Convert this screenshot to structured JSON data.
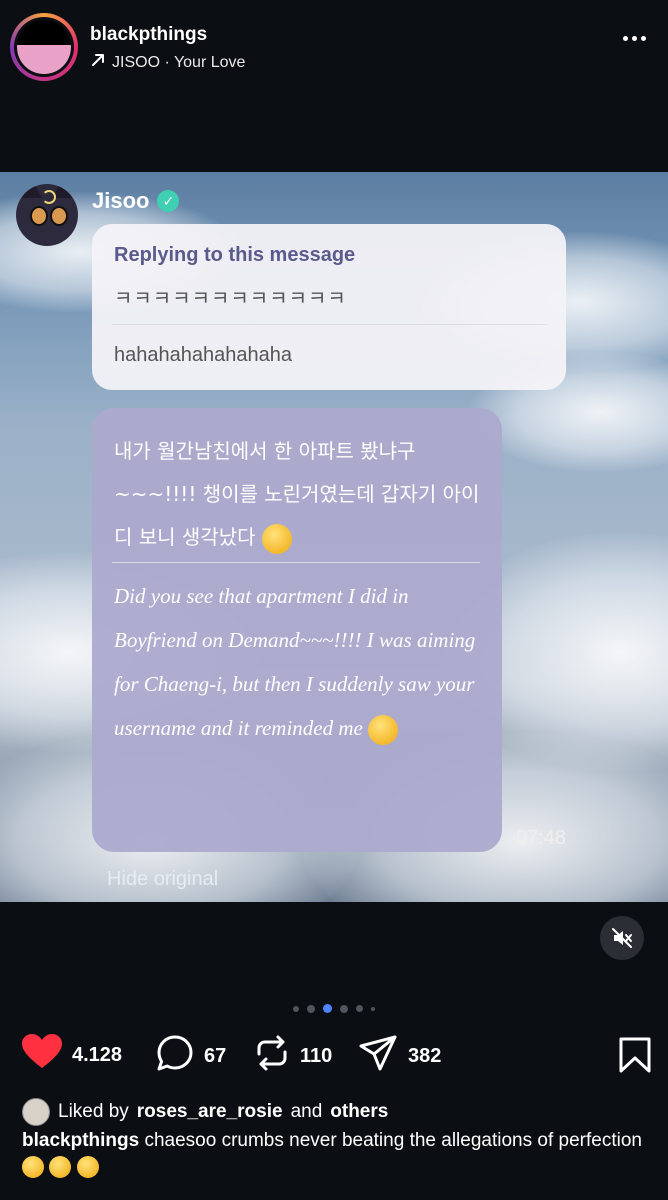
{
  "post": {
    "username": "blackpthings",
    "music": "JISOO · Your Love"
  },
  "chat": {
    "sender": "Jisoo",
    "reply_title": "Replying to this message",
    "reply_original": "ㅋㅋㅋㅋㅋㅋㅋㅋㅋㅋㅋㅋ",
    "reply_translation": "hahahahahahahaha",
    "message_original": "내가 월간남친에서 한 아파트 봤냐구 ~~~!!!! 챙이를 노린거였는데 갑자기 아이디 보니 생각났다",
    "message_translation": "Did you see that apartment I did in Boyfriend on Demand~~~!!!! I was aiming for Chaeng-i, but then I suddenly saw your username and it reminded me",
    "time": "07:48",
    "hide_original": "Hide original"
  },
  "carousel": {
    "count": 6,
    "active_index": 2
  },
  "actions": {
    "likes": "4.128",
    "comments": "67",
    "reposts": "110",
    "shares": "382"
  },
  "liked_by": {
    "prefix": "Liked by",
    "user": "roses_are_rosie",
    "and": "and",
    "others": "others"
  },
  "caption": {
    "username": "blackpthings",
    "text": "chaesoo crumbs never beating the allegations of perfection"
  },
  "colors": {
    "background": "#0b0f14",
    "like": "#ff3040",
    "carousel_active": "#4f83ff",
    "verified": "#3fd0b4"
  },
  "icons": [
    "more-icon",
    "arrow-up-right-icon",
    "verified-icon",
    "mute-icon",
    "heart-icon",
    "comment-icon",
    "repost-icon",
    "share-icon",
    "bookmark-icon"
  ]
}
